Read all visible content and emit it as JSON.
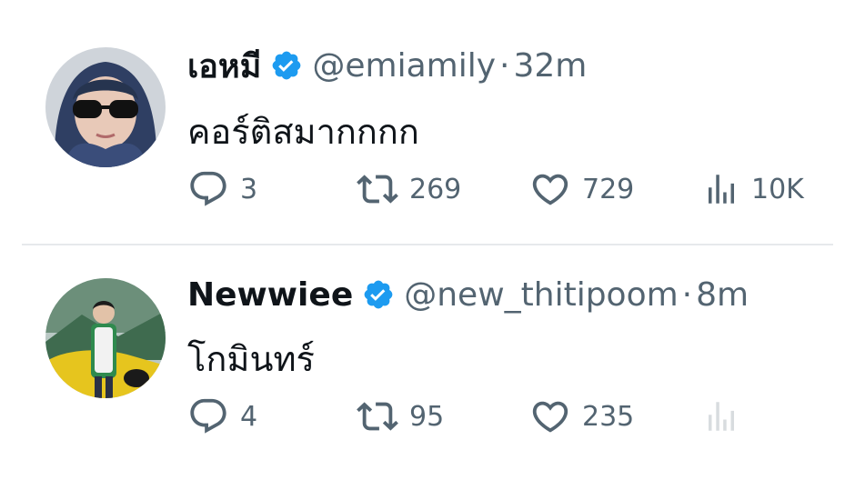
{
  "tweets": [
    {
      "display_name": "เอหมี",
      "handle": "@emiamily",
      "separator": "·",
      "time": "32m",
      "text": "คอร์ติสมากกกก",
      "verified": true,
      "avatar_icon": "profile-photo-hood-sunglasses",
      "reply_count": "3",
      "repost_count": "269",
      "like_count": "729",
      "view_count": "10K"
    },
    {
      "display_name": "Newwiee",
      "handle": "@new_thitipoom",
      "separator": "·",
      "time": "8m",
      "text": "โกมินทร์",
      "verified": true,
      "avatar_icon": "profile-photo-yellow-car",
      "reply_count": "4",
      "repost_count": "95",
      "like_count": "235",
      "view_count": ""
    }
  ],
  "colors": {
    "text_primary": "#0f1419",
    "text_secondary": "#536471",
    "verified_blue": "#1d9bf0",
    "divider": "#e6e9ec"
  },
  "icons": {
    "reply": "reply-icon",
    "repost": "repost-icon",
    "like": "like-icon",
    "views": "views-icon",
    "verified": "verified-badge-icon"
  }
}
